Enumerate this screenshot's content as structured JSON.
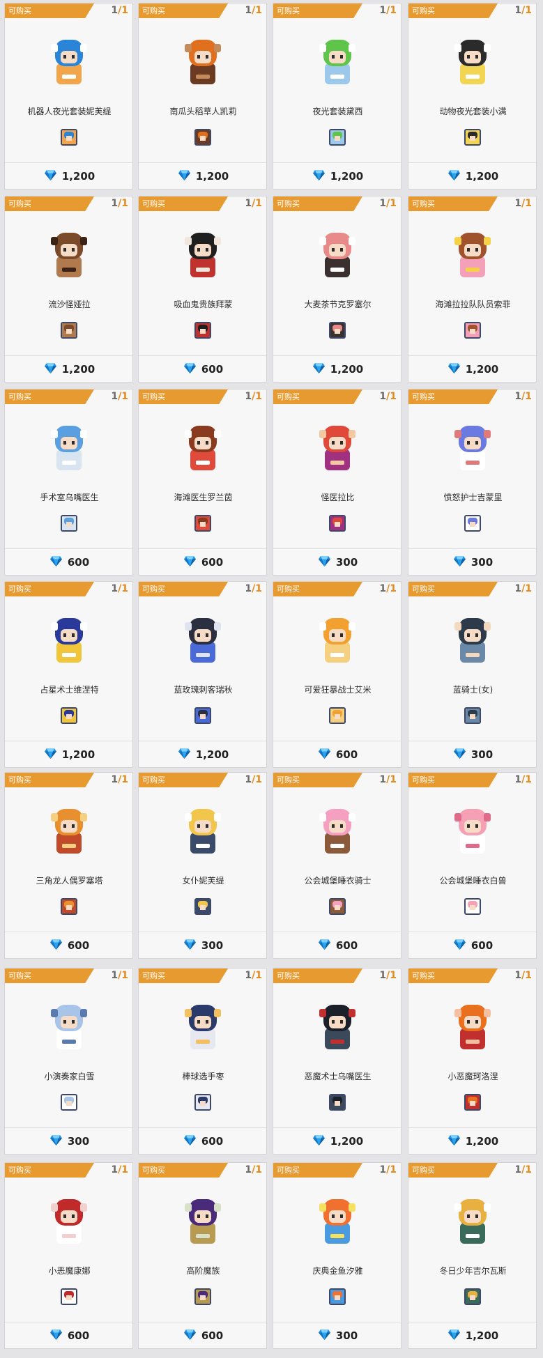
{
  "labels": {
    "tag": "可购买",
    "currency_icon": "diamond-icon"
  },
  "colors": {
    "tag": "#e79a2f",
    "limit_accent": "#e38a1c",
    "gem": "#1e8fdc"
  },
  "items": [
    {
      "name": "机器人夜光套装妮芙缇",
      "price": "1,200",
      "purchased": "1",
      "limit": "1",
      "colors": [
        "#2a84d8",
        "#f2a54a",
        "#ffffff"
      ]
    },
    {
      "name": "南瓜头稻草人凯莉",
      "price": "1,200",
      "purchased": "1",
      "limit": "1",
      "colors": [
        "#e0701e",
        "#6b3a22",
        "#c58a5a"
      ]
    },
    {
      "name": "夜光套装黛西",
      "price": "1,200",
      "purchased": "1",
      "limit": "1",
      "colors": [
        "#5ec44a",
        "#9cc8ec",
        "#ffffff"
      ]
    },
    {
      "name": "动物夜光套装小满",
      "price": "1,200",
      "purchased": "1",
      "limit": "1",
      "colors": [
        "#2b2b2b",
        "#f2d552",
        "#ffffff"
      ]
    },
    {
      "name": "流沙怪娅拉",
      "price": "1,200",
      "purchased": "1",
      "limit": "1",
      "colors": [
        "#7a4a2a",
        "#b07a4e",
        "#3b2416"
      ]
    },
    {
      "name": "吸血鬼贵族拜蒙",
      "price": "600",
      "purchased": "1",
      "limit": "1",
      "colors": [
        "#1f1f1f",
        "#c0322e",
        "#f0e6dc"
      ]
    },
    {
      "name": "大麦茶节克罗塞尔",
      "price": "1,200",
      "purchased": "1",
      "limit": "1",
      "colors": [
        "#e88a8a",
        "#3a3030",
        "#ffffff"
      ]
    },
    {
      "name": "海滩拉拉队队员索菲",
      "price": "1,200",
      "purchased": "1",
      "limit": "1",
      "colors": [
        "#a0522d",
        "#f3a0b8",
        "#f5d14a"
      ]
    },
    {
      "name": "手术室乌嘴医生",
      "price": "600",
      "purchased": "1",
      "limit": "1",
      "colors": [
        "#5aa0e0",
        "#d8e4f0",
        "#ffffff"
      ]
    },
    {
      "name": "海滩医生罗兰茵",
      "price": "600",
      "purchased": "1",
      "limit": "1",
      "colors": [
        "#8a3a1e",
        "#e04a3a",
        "#ffffff"
      ]
    },
    {
      "name": "怪医拉比",
      "price": "300",
      "purchased": "1",
      "limit": "1",
      "colors": [
        "#e0483a",
        "#a03080",
        "#f2c9a0"
      ]
    },
    {
      "name": "愤怒护士吉蒙里",
      "price": "300",
      "purchased": "1",
      "limit": "1",
      "colors": [
        "#6a7ae0",
        "#ffffff",
        "#e07a7a"
      ]
    },
    {
      "name": "占星术士维涅特",
      "price": "1,200",
      "purchased": "1",
      "limit": "1",
      "colors": [
        "#2a3a9a",
        "#f2c63a",
        "#ffffff"
      ]
    },
    {
      "name": "蓝玫瑰刺客瑞秋",
      "price": "1,200",
      "purchased": "1",
      "limit": "1",
      "colors": [
        "#2b2f40",
        "#4a6ad8",
        "#e0e4f0"
      ]
    },
    {
      "name": "可爱狂暴战士艾米",
      "price": "600",
      "purchased": "1",
      "limit": "1",
      "colors": [
        "#f2a030",
        "#f5d080",
        "#ffffff"
      ]
    },
    {
      "name": "蓝骑士(女)",
      "price": "300",
      "purchased": "1",
      "limit": "1",
      "colors": [
        "#2d3a4a",
        "#6a88a8",
        "#f2d9c0"
      ]
    },
    {
      "name": "三角龙人偶罗塞塔",
      "price": "600",
      "purchased": "1",
      "limit": "1",
      "colors": [
        "#e89030",
        "#c04a2a",
        "#f5d080"
      ]
    },
    {
      "name": "女仆妮芙缇",
      "price": "300",
      "purchased": "1",
      "limit": "1",
      "colors": [
        "#f2c64a",
        "#3a4a6a",
        "#ffffff"
      ]
    },
    {
      "name": "公会城堡睡衣骑士",
      "price": "600",
      "purchased": "1",
      "limit": "1",
      "colors": [
        "#f5a0c0",
        "#8a5a3a",
        "#ffffff"
      ]
    },
    {
      "name": "公会城堡睡衣白兽",
      "price": "600",
      "purchased": "1",
      "limit": "1",
      "colors": [
        "#f5a0b4",
        "#ffffff",
        "#e06a8a"
      ]
    },
    {
      "name": "小演奏家白雪",
      "price": "300",
      "purchased": "1",
      "limit": "1",
      "colors": [
        "#a8c4e8",
        "#ffffff",
        "#5a7ab0"
      ]
    },
    {
      "name": "棒球选手枣",
      "price": "600",
      "purchased": "1",
      "limit": "1",
      "colors": [
        "#2a3a6a",
        "#e8e8f0",
        "#f2c060"
      ]
    },
    {
      "name": "恶魔术士乌嘴医生",
      "price": "1,200",
      "purchased": "1",
      "limit": "1",
      "colors": [
        "#1a1f2a",
        "#3a4a5a",
        "#c03030"
      ]
    },
    {
      "name": "小恶魔珂洛涅",
      "price": "1,200",
      "purchased": "1",
      "limit": "1",
      "colors": [
        "#e8701e",
        "#c0302e",
        "#f5c0a0"
      ]
    },
    {
      "name": "小恶魔康娜",
      "price": "600",
      "purchased": "1",
      "limit": "1",
      "colors": [
        "#c02a2a",
        "#ffffff",
        "#f2d0d0"
      ]
    },
    {
      "name": "高阶魔族",
      "price": "600",
      "purchased": "1",
      "limit": "1",
      "colors": [
        "#4a2a7a",
        "#b89a50",
        "#d8e0c8"
      ]
    },
    {
      "name": "庆典金鱼汐雅",
      "price": "300",
      "purchased": "1",
      "limit": "1",
      "colors": [
        "#f07030",
        "#4a9ae0",
        "#f5e060"
      ]
    },
    {
      "name": "冬日少年吉尔瓦斯",
      "price": "1,200",
      "purchased": "1",
      "limit": "1",
      "colors": [
        "#e8b040",
        "#3a6a5a",
        "#ffffff"
      ]
    }
  ]
}
